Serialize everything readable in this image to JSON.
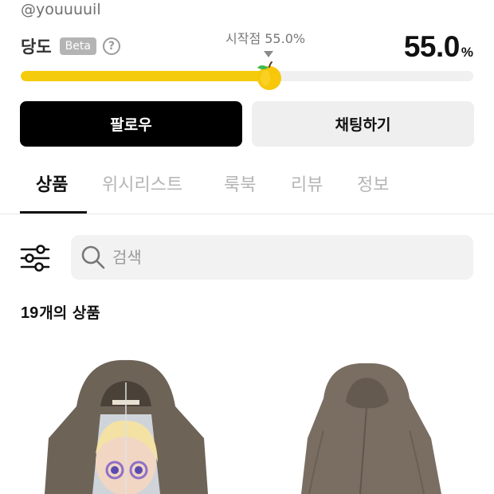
{
  "profile": {
    "handle": "@youuuuil"
  },
  "sweetness": {
    "label": "당도",
    "beta_label": "Beta",
    "help_symbol": "?",
    "start_caption": "시작점 55.0%",
    "value_number": "55.0",
    "value_unit": "%",
    "level_percent": 55.0,
    "track_color": "#f5cb0e",
    "icon": "apple-icon"
  },
  "actions": {
    "follow_label": "팔로우",
    "chat_label": "채팅하기"
  },
  "tabs": [
    {
      "label": "상품",
      "active": true
    },
    {
      "label": "위시리스트",
      "active": false
    },
    {
      "label": "룩북",
      "active": false
    },
    {
      "label": "리뷰",
      "active": false
    },
    {
      "label": "정보",
      "active": false
    }
  ],
  "search": {
    "placeholder": "검색",
    "icon": "search-icon",
    "filter_icon": "filter-sliders-icon"
  },
  "products_summary": {
    "count": "19",
    "suffix": "개의 상품"
  },
  "products": [
    {
      "description": "brown zip hoodie with printed doll graphic"
    },
    {
      "description": "brown hooded zip jacket"
    }
  ],
  "colors": {
    "accent_yellow": "#f5cb0e",
    "primary_button": "#000000",
    "secondary_button": "#efefef",
    "product_brown": "#6e6357"
  }
}
